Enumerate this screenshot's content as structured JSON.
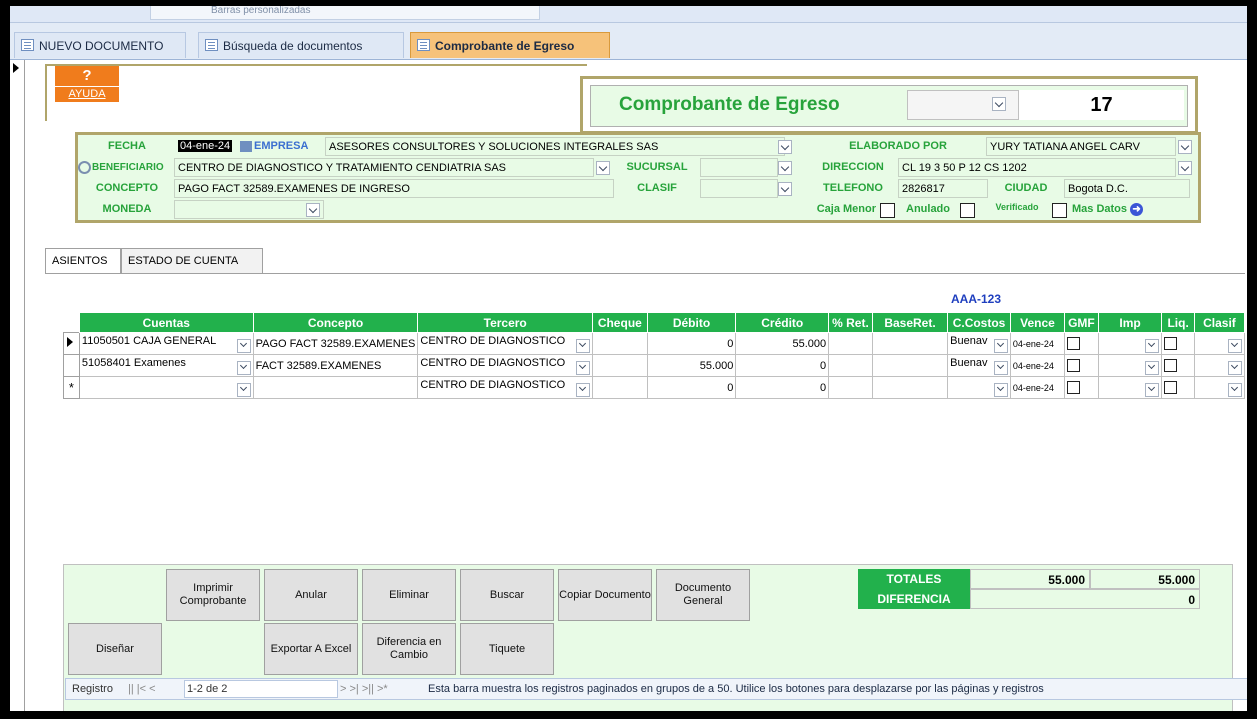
{
  "ribbon": {
    "fragment": "Barras personalizadas"
  },
  "tabs": [
    {
      "label": "NUEVO DOCUMENTO"
    },
    {
      "label": "Búsqueda de documentos"
    },
    {
      "label": "Comprobante de Egreso"
    }
  ],
  "help": {
    "symbol": "?",
    "label": "AYUDA"
  },
  "header": {
    "title": "Comprobante de Egreso",
    "number": "17"
  },
  "fields": {
    "fecha_label": "FECHA",
    "fecha": "04-ene-24",
    "empresa_label": "EMPRESA",
    "empresa": "ASESORES CONSULTORES Y SOLUCIONES INTEGRALES SAS",
    "elaborado_label": "ELABORADO POR",
    "elaborado": "YURY TATIANA ANGEL CARV",
    "beneficiario_label": "BENEFICIARIO",
    "beneficiario": "CENTRO DE DIAGNOSTICO Y TRATAMIENTO CENDIATRIA SAS",
    "sucursal_label": "SUCURSAL",
    "sucursal": "",
    "direccion_label": "DIRECCION",
    "direccion": "CL 19 3 50 P 12 CS 1202",
    "concepto_label": "CONCEPTO",
    "concepto": "PAGO FACT 32589.EXAMENES DE INGRESO",
    "clasif_label": "CLASIF",
    "clasif": "",
    "telefono_label": "TELEFONO",
    "telefono": "2826817",
    "ciudad_label": "CIUDAD",
    "ciudad": "Bogota D.C.",
    "moneda_label": "MONEDA",
    "moneda": "",
    "caja_menor_label": "Caja Menor",
    "anulado_label": "Anulado",
    "verificado_label": "Verificado",
    "mas_datos_label": "Mas Datos"
  },
  "subtabs": [
    {
      "label": "ASIENTOS"
    },
    {
      "label": "ESTADO DE CUENTA"
    }
  ],
  "placa": "AAA-123",
  "grid": {
    "columns": [
      "Cuentas",
      "Concepto",
      "Tercero",
      "Cheque",
      "Débito",
      "Crédito",
      "% Ret.",
      "BaseRet.",
      "C.Costos",
      "Vence",
      "GMF",
      "Imp",
      "Liq.",
      "Clasif"
    ],
    "rows": [
      {
        "cuenta": "11050501 CAJA GENERAL",
        "concepto": "PAGO FACT 32589.EXAMENES",
        "tercero": "CENTRO DE DIAGNOSTICO",
        "cheque": "",
        "debito": "0",
        "credito": "55.000",
        "ret": "",
        "baseret": "",
        "ccostos": "Buenaventura",
        "vence": "04-ene-24"
      },
      {
        "cuenta": "51058401 Examenes",
        "concepto": "FACT 32589.EXAMENES",
        "tercero": "CENTRO DE DIAGNOSTICO",
        "cheque": "",
        "debito": "55.000",
        "credito": "0",
        "ret": "",
        "baseret": "",
        "ccostos": "Buenaventura",
        "vence": "04-ene-24"
      },
      {
        "cuenta": "",
        "concepto": "",
        "tercero": "CENTRO DE DIAGNOSTICO",
        "cheque": "",
        "debito": "0",
        "credito": "0",
        "ret": "",
        "baseret": "",
        "ccostos": "",
        "vence": "04-ene-24"
      }
    ],
    "new_row_marker": "*"
  },
  "buttons": {
    "imprimir": "Imprimir Comprobante",
    "anular": "Anular",
    "eliminar": "Eliminar",
    "buscar": "Buscar",
    "copiar": "Copiar Documento",
    "documento_general": "Documento General",
    "disenar": "Diseñar",
    "exportar": "Exportar A Excel",
    "diferencia_cambio": "Diferencia en Cambio",
    "tiquete": "Tiquete"
  },
  "totals": {
    "totales_label": "TOTALES",
    "debito": "55.000",
    "credito": "55.000",
    "diferencia_label": "DIFERENCIA",
    "diferencia": "0"
  },
  "navigation": {
    "label": "Registro",
    "first_prev": "|| |<  <",
    "record": "1-2 de 2",
    "next_last": ">  >|  >|| >*",
    "hint": "Esta barra muestra los registros paginados en grupos de a 50.  Utilice los botones para desplazarse por las páginas y registros"
  }
}
